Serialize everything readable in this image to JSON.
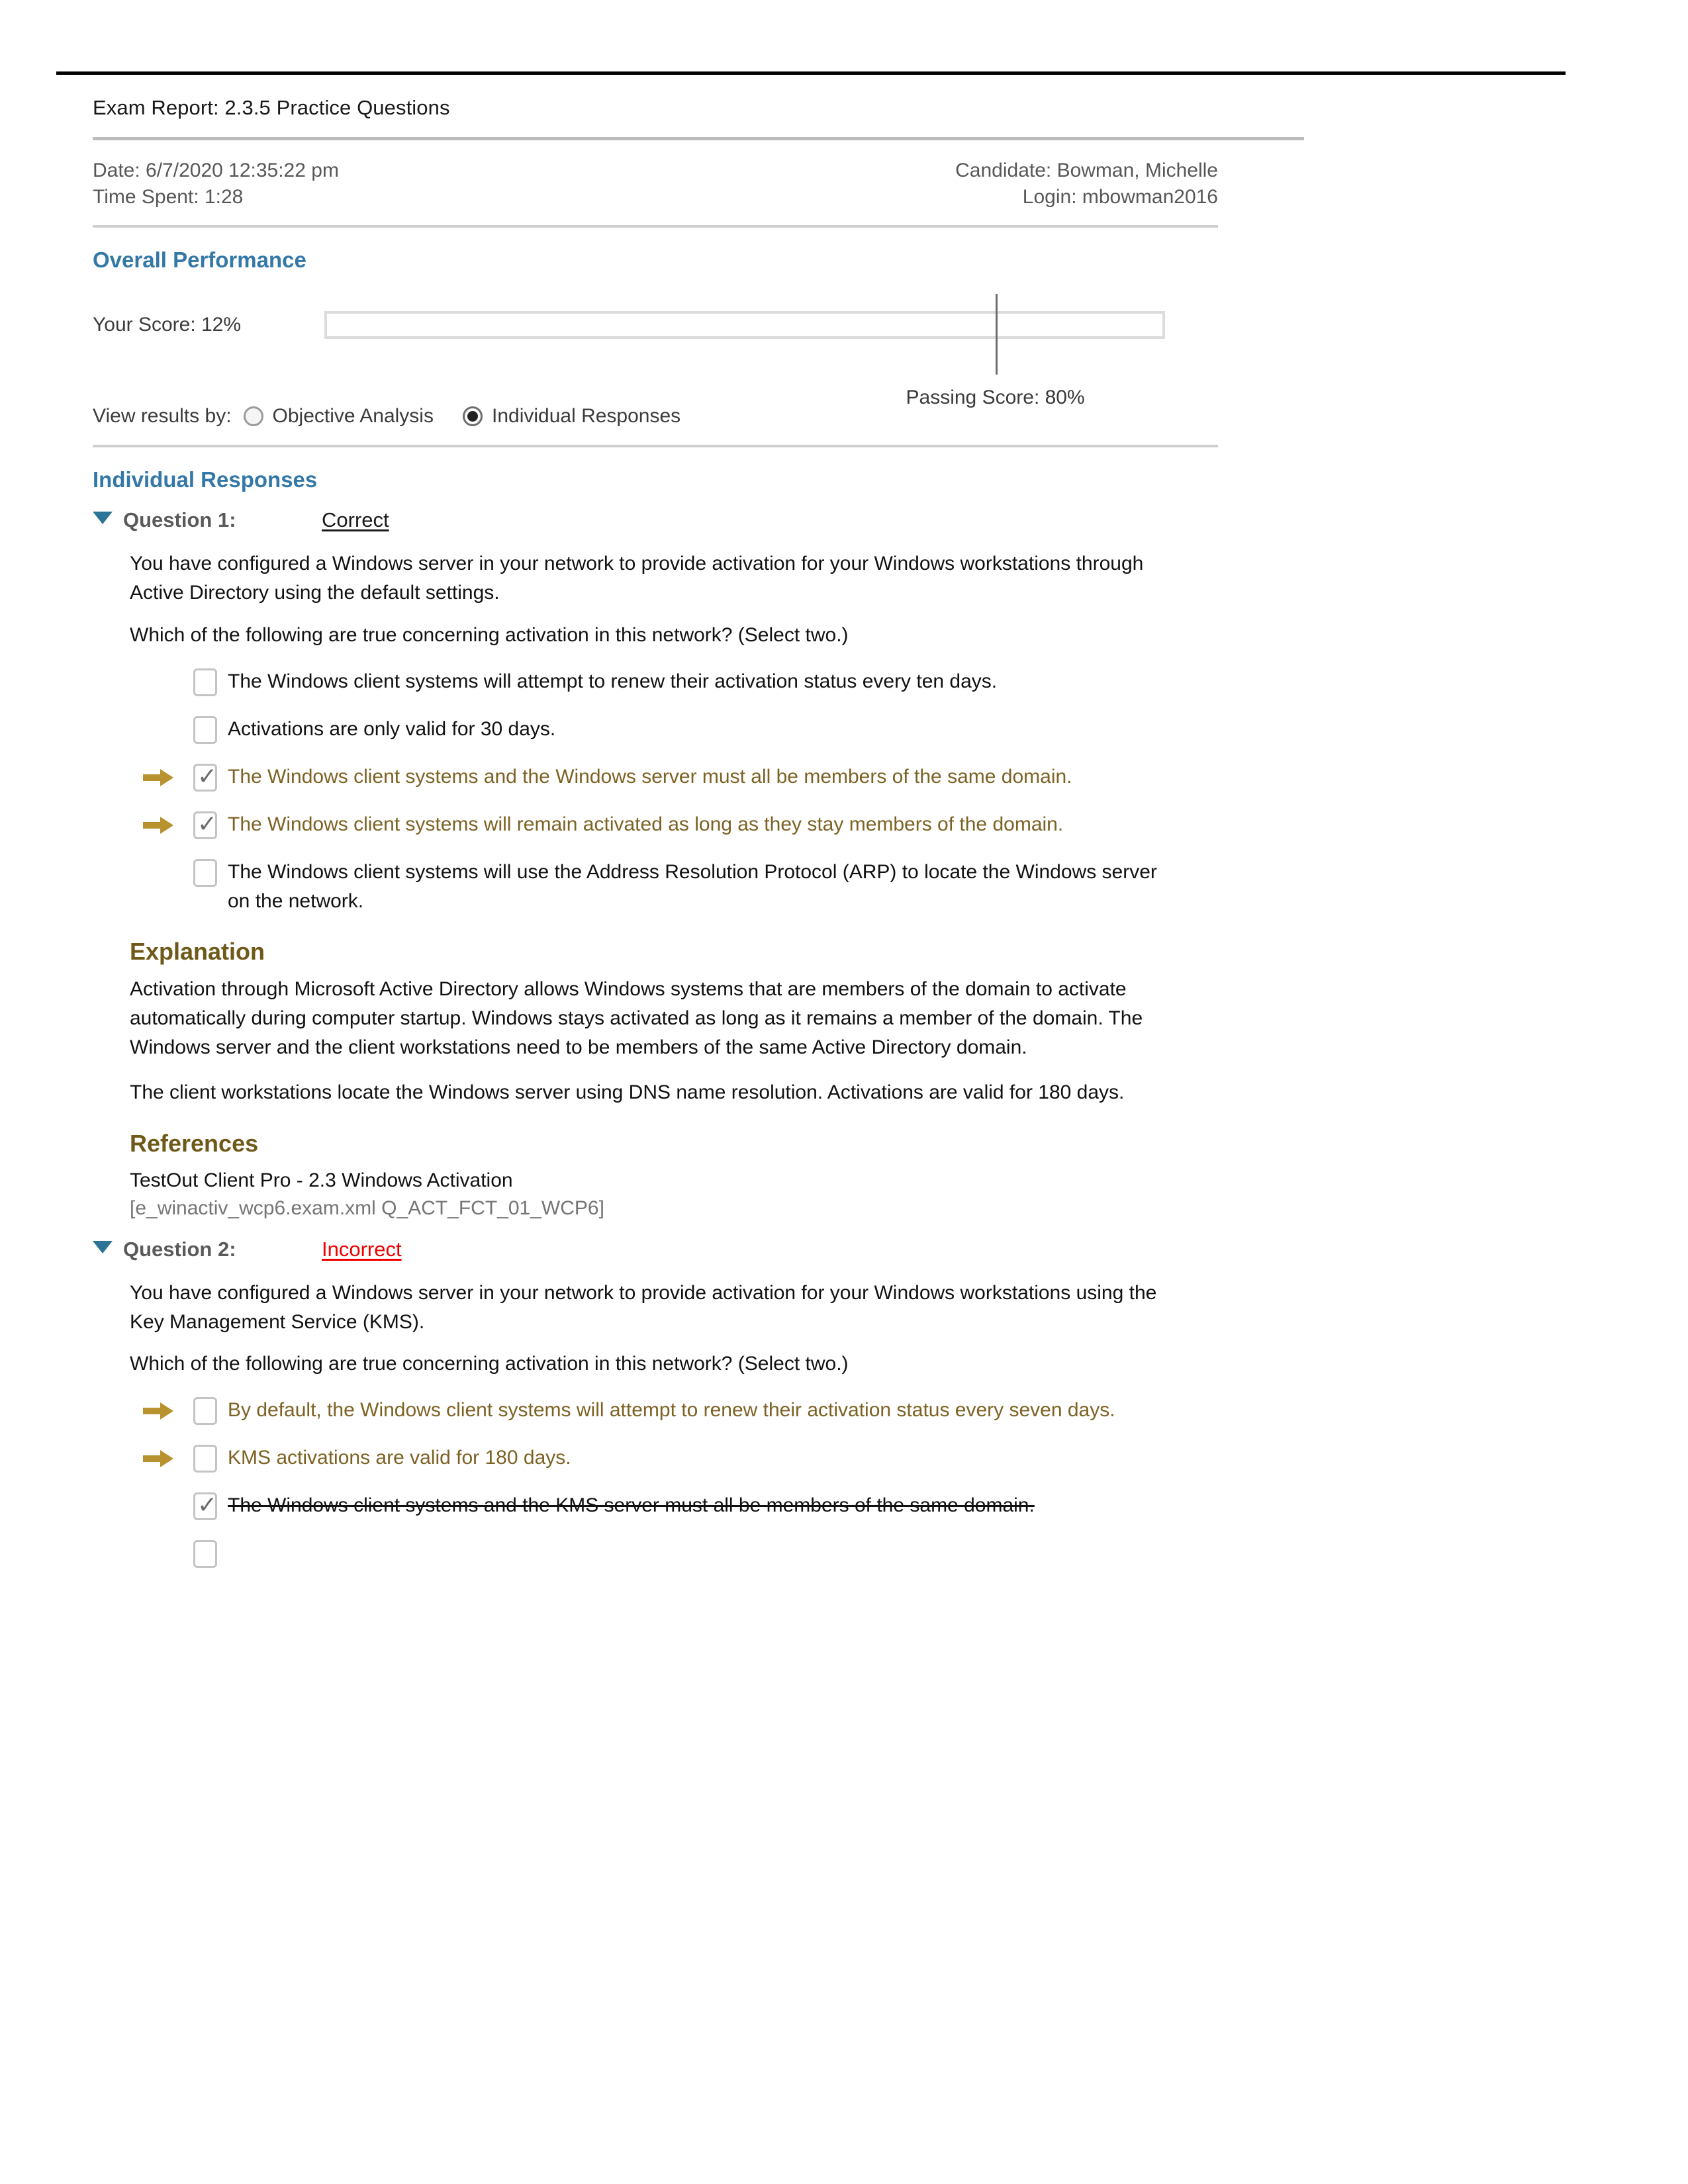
{
  "header": {
    "exam_title": "Exam Report: 2.3.5 Practice Questions",
    "date_label": "Date: 6/7/2020 12:35:22 pm",
    "time_spent_label": "Time Spent: 1:28",
    "candidate_label": "Candidate: Bowman, Michelle",
    "login_label": "Login: mbowman2016"
  },
  "overall_performance": {
    "heading": "Overall Performance",
    "your_score_label": "Your Score: 12%",
    "your_score_percent": 12,
    "passing_score_label": "Passing Score:  80%",
    "passing_score_percent": 80,
    "bar_border_color": "#dcdcdc",
    "marker_color": "#6e6e6e"
  },
  "view_results": {
    "prompt": "View results by:",
    "options": [
      {
        "label": "Objective Analysis",
        "selected": false
      },
      {
        "label": "Individual Responses",
        "selected": true
      }
    ]
  },
  "individual_responses": {
    "heading": "Individual Responses",
    "questions": [
      {
        "label": "Question 1:",
        "status": "Correct",
        "status_kind": "correct",
        "stem": [
          "You have configured a Windows server in your network to provide activation for your Windows workstations through Active Directory using the default settings.",
          "Which of the following are true concerning activation in this network? (Select two.)"
        ],
        "options": [
          {
            "text": "The Windows client systems will attempt to renew their activation status every ten days.",
            "arrow": false,
            "checked": false,
            "style": "plain"
          },
          {
            "text": "Activations are only valid for 30 days.",
            "arrow": false,
            "checked": false,
            "style": "plain"
          },
          {
            "text": "The Windows client systems and the Windows server must all be members of the same domain.",
            "arrow": true,
            "checked": true,
            "style": "key"
          },
          {
            "text": "The Windows client systems will remain activated as long as they stay members of the domain.",
            "arrow": true,
            "checked": true,
            "style": "key"
          },
          {
            "text": "The Windows client systems will use the Address Resolution Protocol (ARP) to locate the Windows server on the network.",
            "arrow": false,
            "checked": false,
            "style": "plain"
          }
        ],
        "explanation_heading": "Explanation",
        "explanation": [
          "Activation through Microsoft Active Directory allows Windows systems that are members of the domain to activate automatically during computer startup. Windows stays activated as long as it remains a member of the domain. The Windows server and the client workstations need to be members of the same Active Directory domain.",
          "The client workstations locate the Windows server using DNS name resolution. Activations are valid for 180 days."
        ],
        "references_heading": "References",
        "reference_title": "TestOut Client Pro - 2.3 Windows Activation",
        "reference_id": "[e_winactiv_wcp6.exam.xml Q_ACT_FCT_01_WCP6]"
      },
      {
        "label": "Question 2:",
        "status": "Incorrect",
        "status_kind": "incorrect",
        "stem": [
          "You have configured a Windows server in your network to provide activation for your Windows workstations using the Key Management Service (KMS).",
          "Which of the following are true concerning activation in this network? (Select two.)"
        ],
        "options": [
          {
            "text": "By default, the Windows client systems will attempt to renew their activation status every seven days.",
            "arrow": true,
            "checked": false,
            "style": "key"
          },
          {
            "text": "KMS activations are valid for 180 days.",
            "arrow": true,
            "checked": false,
            "style": "key"
          },
          {
            "text": "The Windows client systems and the KMS server must all be members of the same domain.",
            "arrow": false,
            "checked": true,
            "style": "struck"
          },
          {
            "text": "",
            "arrow": false,
            "checked": false,
            "style": "plain"
          }
        ]
      }
    ]
  },
  "colors": {
    "heading_blue": "#3478a8",
    "subheading_gold": "#6f5918",
    "key_answer_gold": "#7c6223",
    "arrow_gold": "#b8922f",
    "incorrect_red": "#ee0000",
    "triangle_blue": "#2e7496"
  }
}
